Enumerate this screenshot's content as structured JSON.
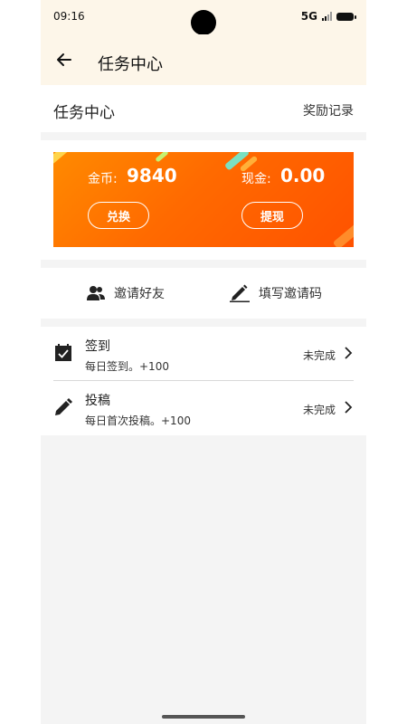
{
  "status_bar": {
    "time": "09:16",
    "network": "5G"
  },
  "app_bar": {
    "back_icon": "arrow-left-icon",
    "title": "任务中心"
  },
  "header": {
    "title": "任务中心",
    "reward_record_link": "奖励记录"
  },
  "banner": {
    "coin_label": "金币:",
    "coin_value": "9840",
    "cash_label": "现金:",
    "cash_value": "0.00",
    "exchange_button": "兑换",
    "withdraw_button": "提现",
    "gradient_colors": [
      "#ff8a00",
      "#ff5200"
    ]
  },
  "invite": {
    "invite_friends": {
      "icon": "people-icon",
      "label": "邀请好友"
    },
    "fill_invite_code": {
      "icon": "pencil-icon",
      "label": "填写邀请码"
    }
  },
  "tasks": [
    {
      "icon": "calendar-check-icon",
      "title": "签到",
      "description": "每日签到。+100",
      "status": "未完成"
    },
    {
      "icon": "pencil-icon",
      "title": "投稿",
      "description": "每日首次投稿。+100",
      "status": "未完成"
    }
  ],
  "colors": {
    "status_bar_bg": "#fdf6e9",
    "page_bg": "#f4f4f4",
    "accent_orange": "#ff6a00"
  }
}
